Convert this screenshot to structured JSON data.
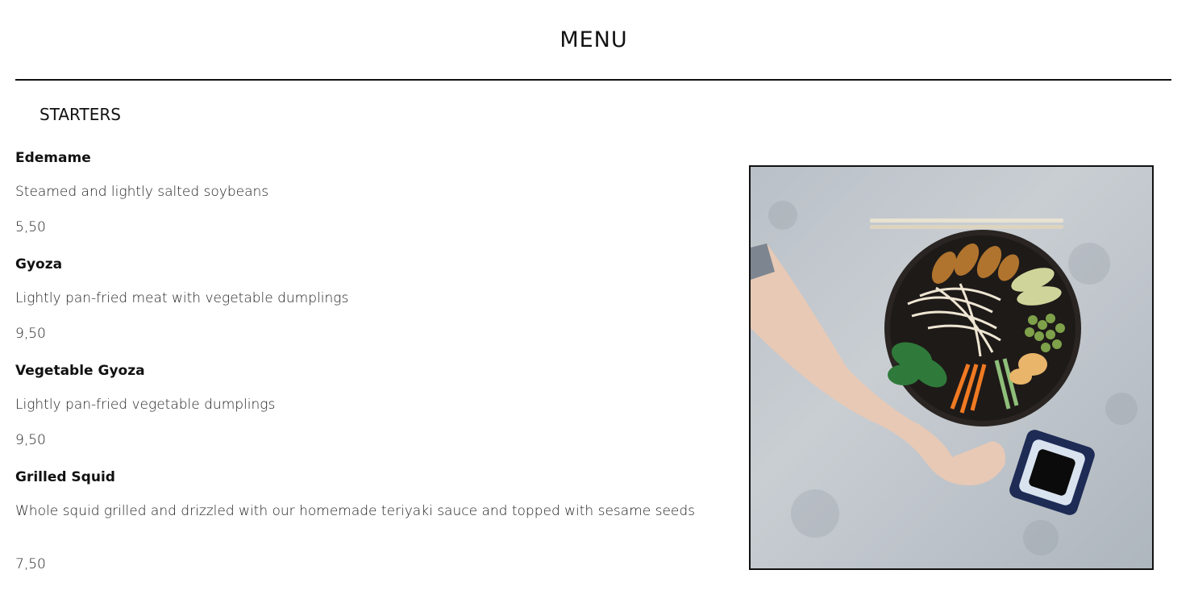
{
  "header": {
    "title": "MENU"
  },
  "section": {
    "title": "STARTERS"
  },
  "items": [
    {
      "name": "Edemame",
      "description": "Steamed and lightly salted soybeans",
      "price": "5,50"
    },
    {
      "name": "Gyoza",
      "description": "Lightly pan-fried meat with vegetable dumplings",
      "price": "9,50"
    },
    {
      "name": "Vegetable Gyoza",
      "description": "Lightly pan-fried vegetable dumplings",
      "price": "9,50"
    },
    {
      "name": "Grilled Squid",
      "description": "Whole squid grilled and drizzled with our homemade teriyaki sauce and topped with sesame seeds",
      "price": "7,50"
    }
  ]
}
